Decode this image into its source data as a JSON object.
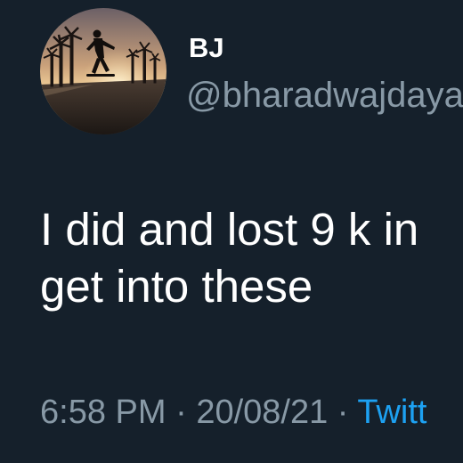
{
  "user": {
    "display_name": "BJ",
    "handle": "@bharadwajdaya"
  },
  "tweet": {
    "line1": "I did and lost 9 k in",
    "line2": "get into these"
  },
  "meta": {
    "time": "6:58 PM",
    "separator1": " · ",
    "date": "20/08/21",
    "separator2": " · ",
    "source": "Twitt"
  },
  "colors": {
    "background": "#15202b",
    "primary_text": "#ffffff",
    "secondary_text": "#8899a6",
    "link": "#1da1f2"
  },
  "icons": {
    "avatar": "profile-photo-sunset-skater"
  }
}
